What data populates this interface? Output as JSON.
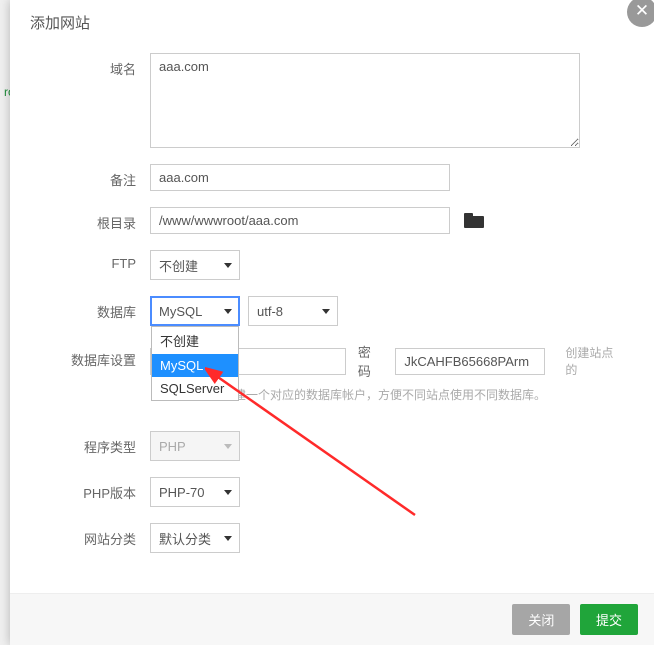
{
  "background_sidebar_hint": "root",
  "modal": {
    "title": "添加网站",
    "close_glyph": "✕"
  },
  "form": {
    "domain_label": "域名",
    "domain_value": "aaa.com",
    "remark_label": "备注",
    "remark_value": "aaa.com",
    "root_label": "根目录",
    "root_value": "/www/wwwroot/aaa.com",
    "ftp_label": "FTP",
    "ftp_value": "不创建",
    "db_label": "数据库",
    "db_value": "MySQL",
    "db_options": [
      "不创建",
      "MySQL",
      "SQLServer"
    ],
    "charset_value": "utf-8",
    "dbset_label": "数据库设置",
    "dbset_pwd_label": "密码",
    "dbset_pwd_value": "JkCAHFB65668PArm",
    "dbset_side_hint": "创建站点的",
    "dbset_bottom_hint": "同时，为站点创建一个对应的数据库帐户，方便不同站点使用不同数据库。",
    "program_label": "程序类型",
    "program_value": "PHP",
    "phpver_label": "PHP版本",
    "phpver_value": "PHP-70",
    "cat_label": "网站分类",
    "cat_value": "默认分类"
  },
  "footer": {
    "close": "关闭",
    "submit": "提交"
  }
}
